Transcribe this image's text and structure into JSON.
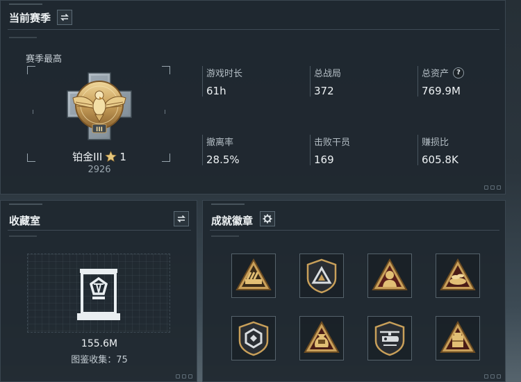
{
  "season": {
    "title": "当前赛季",
    "highest_label": "赛季最高",
    "rank_name": "铂金III",
    "stars": "1",
    "score": "2926",
    "stats": [
      {
        "label": "游戏时长",
        "value": "61h"
      },
      {
        "label": "总战局",
        "value": "372"
      },
      {
        "label": "总资产",
        "value": "769.9M",
        "help": "?"
      },
      {
        "label": "撤离率",
        "value": "28.5%"
      },
      {
        "label": "击败干员",
        "value": "169"
      },
      {
        "label": "赚损比",
        "value": "605.8K"
      }
    ]
  },
  "collection": {
    "title": "收藏室",
    "value": "155.6M",
    "count_text": "图鉴收集：75"
  },
  "achievements": {
    "title": "成就徽章",
    "badges": [
      {
        "icon": "missile-launcher-badge-icon"
      },
      {
        "icon": "mountain-shield-badge-icon"
      },
      {
        "icon": "soldier-portrait-badge-icon"
      },
      {
        "icon": "treasure-pile-badge-icon"
      },
      {
        "icon": "hexagon-emblem-badge-icon"
      },
      {
        "icon": "money-bag-badge-icon"
      },
      {
        "icon": "helicopter-badge-icon"
      },
      {
        "icon": "supply-crate-badge-icon"
      }
    ]
  },
  "colors": {
    "panel_bg": "#1f282f",
    "gold": "#c9a05a",
    "text_primary": "#eef2f4",
    "text_secondary": "#b4bec5"
  }
}
